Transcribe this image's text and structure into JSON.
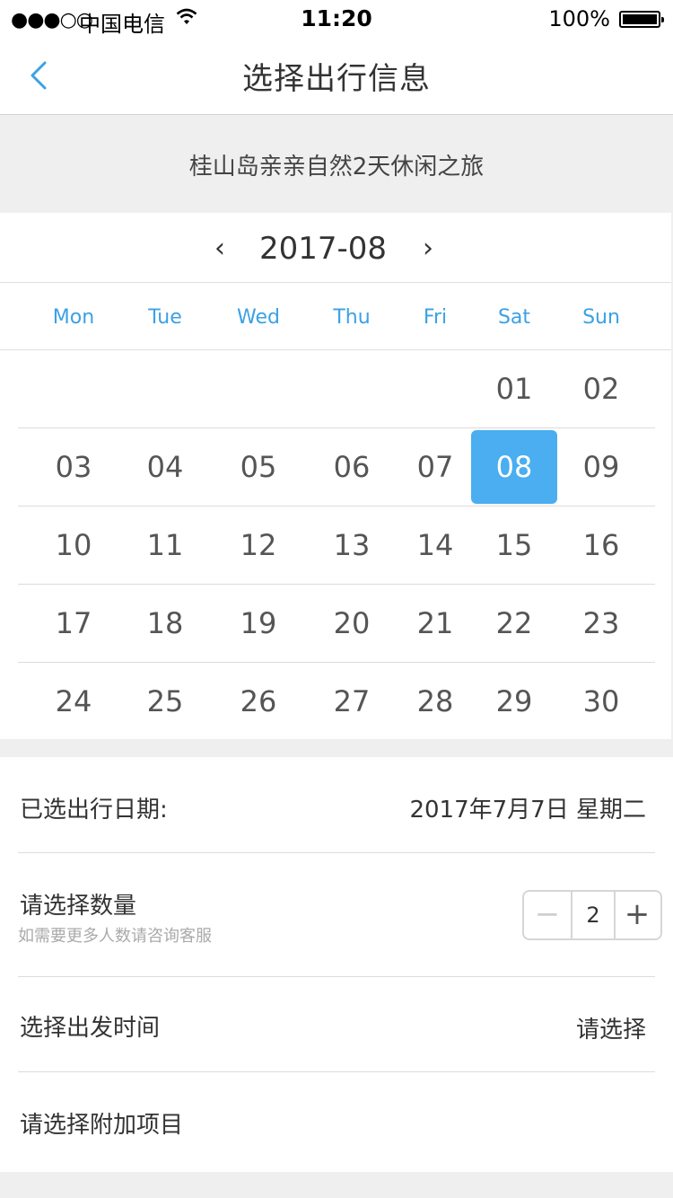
{
  "status_bar": {
    "signal": "●●●○○",
    "carrier": "中国电信",
    "time": "11:20",
    "battery": "100%"
  },
  "nav": {
    "title": "选择出行信息"
  },
  "trip": {
    "name": "桂山岛亲亲自然2天休闲之旅"
  },
  "calendar": {
    "prev": "‹",
    "next": "›",
    "month": "2017-08",
    "weekdays": [
      "Mon",
      "Tue",
      "Wed",
      "Thu",
      "Fri",
      "Sat",
      "Sun"
    ],
    "weeks": [
      [
        "",
        "",
        "",
        "",
        "",
        "01",
        "02"
      ],
      [
        "03",
        "04",
        "05",
        "06",
        "07",
        "08",
        "09"
      ],
      [
        "10",
        "11",
        "12",
        "13",
        "14",
        "15",
        "16"
      ],
      [
        "17",
        "18",
        "19",
        "20",
        "21",
        "22",
        "23"
      ],
      [
        "24",
        "25",
        "26",
        "27",
        "28",
        "29",
        "30"
      ]
    ],
    "selected": "08",
    "accent_color": "#4aaef0"
  },
  "form": {
    "date_label": "已选出行日期:",
    "date_value": "2017年7月7日 星期二",
    "quantity_label": "请选择数量",
    "quantity_hint": "如需要更多人数请咨询客服",
    "quantity_minus": "−",
    "quantity_value": "2",
    "quantity_plus": "+",
    "departure_label": "选择出发时间",
    "departure_value": "请选择",
    "addon_label": "请选择附加项目"
  }
}
